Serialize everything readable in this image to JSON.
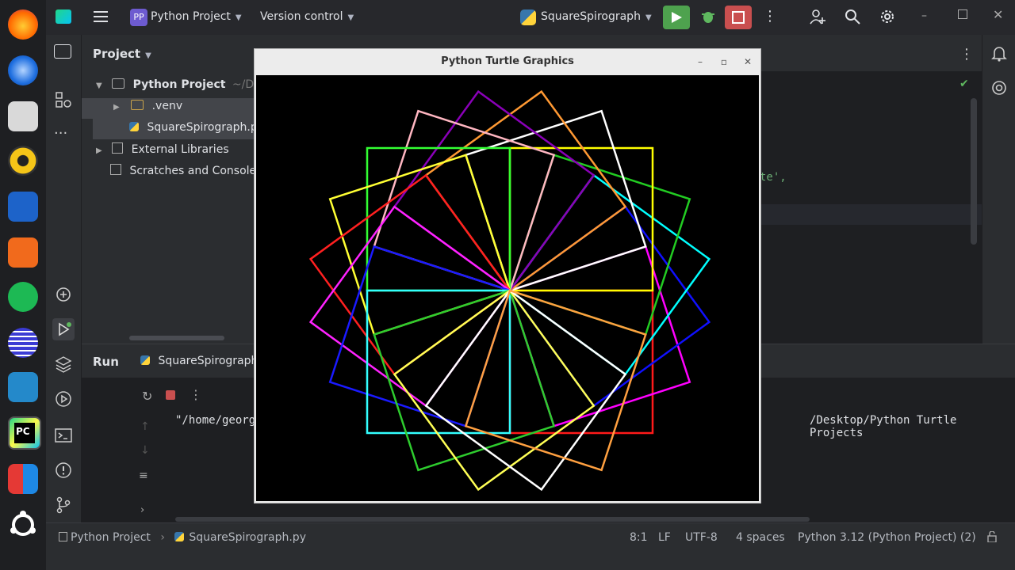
{
  "ide": {
    "topbar": {
      "project_badge": "PP",
      "project_name": "Python Project",
      "vcs": "Version control",
      "run_config": "SquareSpirograph"
    },
    "project_panel": {
      "title": "Project",
      "root": "Python Project",
      "root_path": "~/Des",
      "venv": ".venv",
      "file": "SquareSpirograph.py",
      "external": "External Libraries",
      "scratches": "Scratches and Consoles"
    },
    "editor": {
      "code_fragment": "te',"
    },
    "run_panel": {
      "tab_run": "Run",
      "tab_config": "SquareSpirograph",
      "cmd_start": "\"/home/george/Desk",
      "cmd_end": "/Desktop/Python Turtle Projects"
    },
    "status": {
      "crumb_project": "Python Project",
      "crumb_file": "SquareSpirograph.py",
      "position": "8:1",
      "line_sep": "LF",
      "encoding": "UTF-8",
      "indent": "4 spaces",
      "interpreter": "Python 3.12 (Python Project) (2)"
    }
  },
  "turtle_window": {
    "title": "Python Turtle Graphics",
    "spiro_colors": [
      "#ff1a1a",
      "#ff00ff",
      "#1010ff",
      "#00ffff",
      "#22cc22",
      "#ffff00",
      "#ffffff",
      "#ff9933",
      "#8a00b8",
      "#ffb6c1",
      "#33ff33",
      "#ffff33",
      "#ff2020",
      "#ff22ff",
      "#1a1aff",
      "#33ffff",
      "#2ecc2e",
      "#ffff55",
      "#ffffff",
      "#ffa040"
    ],
    "background": "#000000"
  }
}
